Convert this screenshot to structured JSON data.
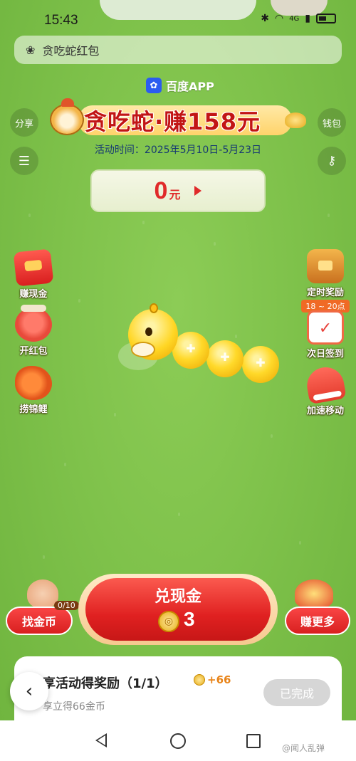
{
  "status_bar": {
    "time": "15:43",
    "network": "4G"
  },
  "search": {
    "text": "贪吃蛇红包"
  },
  "brand": {
    "label": "百度APP"
  },
  "banner": {
    "title": "贪吃蛇·赚158元"
  },
  "activity": {
    "time": "活动时间：2025年5月10日-5月23日"
  },
  "top_buttons": {
    "share": "分享",
    "wallet": "钱包"
  },
  "amount": {
    "value": "0",
    "unit": "元"
  },
  "left_features": [
    {
      "label": "赚现金",
      "icon": "red-envelope-icon"
    },
    {
      "label": "开红包",
      "icon": "dragon-icon"
    },
    {
      "label": "捞锦鲤",
      "icon": "koi-icon"
    }
  ],
  "right_features": [
    {
      "label": "定时奖励",
      "badge": "18 ~ 20点",
      "icon": "treasure-chest-icon"
    },
    {
      "label": "次日签到",
      "icon": "calendar-icon"
    },
    {
      "label": "加速移动",
      "icon": "sneaker-icon"
    }
  ],
  "find_coin": {
    "label": "找金币",
    "count": "0/10"
  },
  "exchange": {
    "label": "兑现金",
    "coins": "3"
  },
  "earn_more": {
    "label": "赚更多"
  },
  "task": {
    "title": "享活动得奖励（1/1）",
    "reward": "+66",
    "description": "享立得66金币",
    "status": "已完成"
  },
  "watermark": "@闻人乱弹",
  "colors": {
    "accent_red": "#e02a2a",
    "grass": "#7fc24b",
    "coin_gold": "#e6ad1a"
  }
}
